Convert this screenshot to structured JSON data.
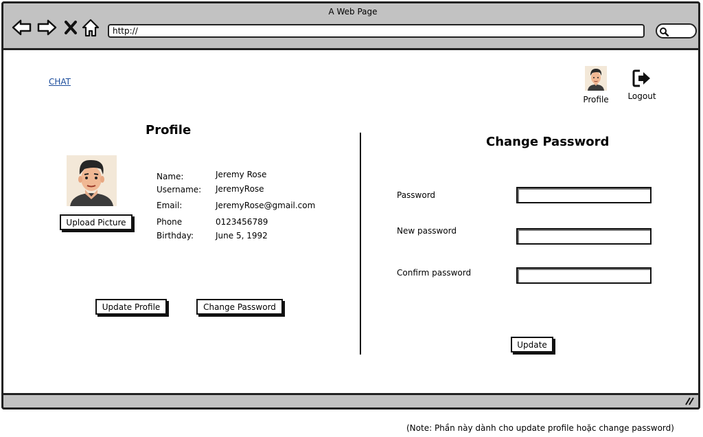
{
  "browser": {
    "title": "A Web Page",
    "url": "http://"
  },
  "nav": {
    "chat_link": "CHAT",
    "profile_label": "Profile",
    "logout_label": "Logout"
  },
  "profile": {
    "heading": "Profile",
    "upload_button": "Upload Picture",
    "fields": [
      {
        "label": "Name:",
        "value": "Jeremy Rose"
      },
      {
        "label": "Username:",
        "value": "JeremyRose"
      },
      {
        "label": "Email:",
        "value": "JeremyRose@gmail.com"
      },
      {
        "label": "Phone",
        "value": "0123456789"
      },
      {
        "label": "Birthday:",
        "value": "June 5, 1992"
      }
    ],
    "update_button": "Update Profile",
    "change_password_button": "Change Password"
  },
  "change_password": {
    "heading": "Change Password",
    "fields": [
      {
        "label": "Password",
        "value": ""
      },
      {
        "label": "New password",
        "value": ""
      },
      {
        "label": "Confirm password",
        "value": ""
      }
    ],
    "update_button": "Update"
  },
  "note": "(Note: Phần này dành cho update profile hoặc change password)"
}
